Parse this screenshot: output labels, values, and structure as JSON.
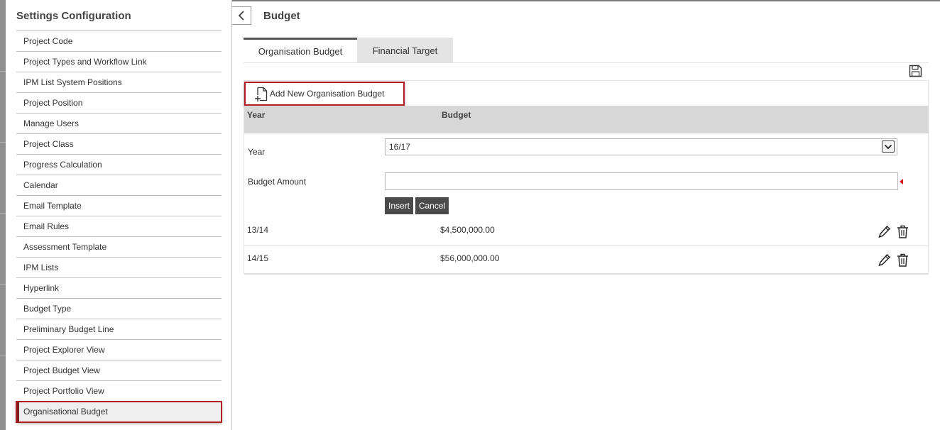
{
  "sidebar": {
    "title": "Settings Configuration",
    "items": [
      {
        "label": "Project Code"
      },
      {
        "label": "Project Types and Workflow Link"
      },
      {
        "label": "IPM List System Positions"
      },
      {
        "label": "Project Position"
      },
      {
        "label": "Manage Users"
      },
      {
        "label": "Project Class"
      },
      {
        "label": "Progress Calculation"
      },
      {
        "label": "Calendar"
      },
      {
        "label": "Email Template"
      },
      {
        "label": "Email Rules"
      },
      {
        "label": "Assessment Template"
      },
      {
        "label": "IPM Lists"
      },
      {
        "label": "Hyperlink"
      },
      {
        "label": "Budget Type"
      },
      {
        "label": "Preliminary Budget Line"
      },
      {
        "label": "Project Explorer View"
      },
      {
        "label": "Project Budget View"
      },
      {
        "label": "Project Portfolio View"
      },
      {
        "label": "Organisational Budget",
        "active": true
      }
    ]
  },
  "header": {
    "title": "Budget",
    "back_icon": "chevron-left-icon"
  },
  "tabs": [
    {
      "label": "Organisation Budget",
      "active": true
    },
    {
      "label": "Financial Target",
      "active": false
    }
  ],
  "toolbar": {
    "save_icon": "save-icon",
    "add_label": "Add New Organisation Budget",
    "add_icon": "add-document-icon"
  },
  "grid": {
    "columns": {
      "year": "Year",
      "budget": "Budget"
    },
    "form": {
      "year_label": "Year",
      "year_value": "16/17",
      "amount_label": "Budget Amount",
      "amount_value": "",
      "insert_label": "Insert",
      "cancel_label": "Cancel"
    },
    "rows": [
      {
        "year": "13/14",
        "budget": "$4,500,000.00"
      },
      {
        "year": "14/15",
        "budget": "$56,000,000.00"
      }
    ]
  },
  "colors": {
    "highlight": "#b01e23",
    "header_bg": "#d7d7d7",
    "button_bg": "#4a4a4a",
    "required": "#d0151b"
  }
}
